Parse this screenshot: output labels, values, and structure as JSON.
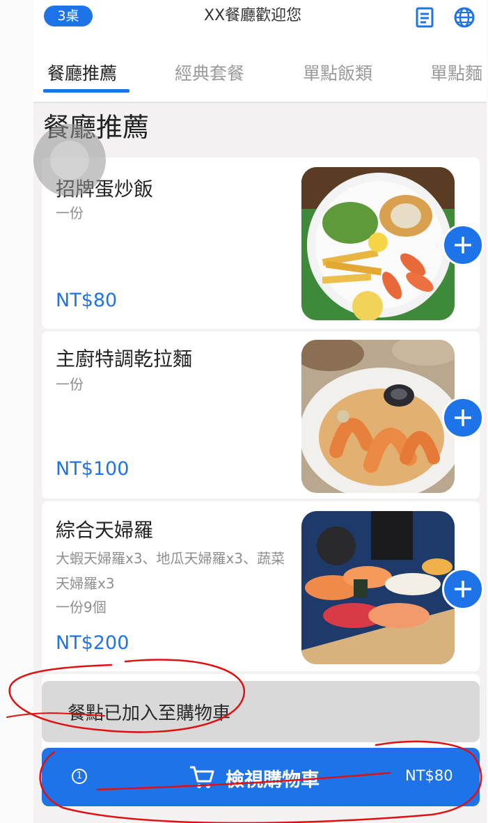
{
  "header": {
    "table_badge": "3桌",
    "title": "XX餐廳歡迎您",
    "order_icon": "receipt-icon",
    "language_icon": "globe-icon"
  },
  "tabs": [
    {
      "label": "餐廳推薦",
      "active": true
    },
    {
      "label": "經典套餐",
      "active": false
    },
    {
      "label": "單點飯類",
      "active": false
    },
    {
      "label": "單點麵",
      "active": false
    }
  ],
  "section": {
    "title": "餐廳推薦"
  },
  "items": [
    {
      "name": "招牌蛋炒飯",
      "desc": "一份",
      "price": "NT$80"
    },
    {
      "name": "主廚特調乾拉麵",
      "desc": "一份",
      "price": "NT$100"
    },
    {
      "name": "綜合天婦羅",
      "desc": "大蝦天婦羅x3、地瓜天婦羅x3、蔬菜天婦羅x3",
      "desc2": "一份9個",
      "price": "NT$200"
    }
  ],
  "toast": {
    "message": "餐點已加入至購物車"
  },
  "cart": {
    "count": "1",
    "label": "檢視購物車",
    "total": "NT$80",
    "icon": "cart-icon"
  },
  "colors": {
    "accent": "#1e73e8",
    "annotation": "#e01010"
  }
}
